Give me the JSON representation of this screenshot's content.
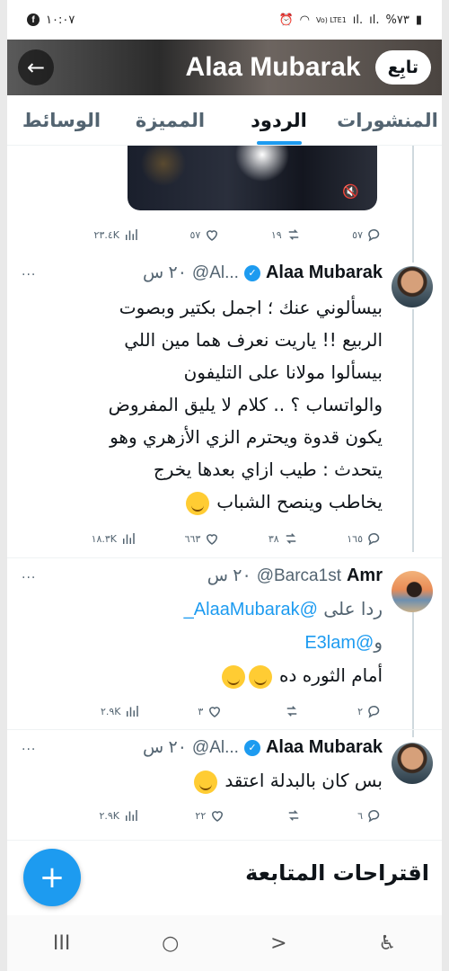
{
  "status_bar": {
    "battery": "%٧٣",
    "network_label": "Vo) LTE1",
    "time": "١٠:٠٧",
    "fb_letter": "f"
  },
  "header": {
    "title": "Alaa Mubarak",
    "follow_label": "تابِع"
  },
  "tabs": [
    {
      "label": "المنشورات",
      "active": false
    },
    {
      "label": "الردود",
      "active": true
    },
    {
      "label": "المميزة",
      "active": false
    },
    {
      "label": "الوسائط",
      "active": false
    }
  ],
  "first_actions": {
    "replies": "٥٧",
    "reposts": "١٩",
    "likes": "٥٧",
    "views": "٢٣.٤K"
  },
  "tweets": [
    {
      "name": "Alaa Mubarak",
      "handle": "@Al...",
      "time": "٢٠ س",
      "lines": [
        "بيسألوني عنك ؛ اجمل بكتير وبصوت",
        "الربيع !! ياريت نعرف هما مين اللي",
        "بيسألوا مولانا على التليفون",
        "والواتساب ؟ .. كلام لا يليق المفروض",
        "يكون قدوة ويحترم الزي الأزهري وهو",
        "يتحدث : طيب ازاي بعدها يخرج",
        "يخاطب وينصح الشباب"
      ],
      "actions": {
        "replies": "١٦٥",
        "reposts": "٣٨",
        "likes": "٦٦٣",
        "views": "١٨.٣K"
      }
    },
    {
      "name": "Amr",
      "handle": "@Barca1st",
      "time": "٢٠ س",
      "reply_prefix": "ردا على",
      "mention1": "@AlaaMubarak_",
      "conj": "و",
      "mention2": "@E3lam",
      "text": "أمام الثوره ده",
      "actions": {
        "replies": "٢",
        "reposts": "",
        "likes": "٣",
        "views": "٢.٩K"
      }
    },
    {
      "name": "Alaa Mubarak",
      "handle": "@Al...",
      "time": "٢٠ س",
      "text": "بس كان بالبدلة اعتقد",
      "actions": {
        "replies": "٦",
        "reposts": "",
        "likes": "٢٢",
        "views": "٢.٩K"
      }
    }
  ],
  "suggestions": {
    "title": "اقتراحات المتابعة"
  },
  "fab": {
    "label": "+"
  },
  "nav": {
    "recent": "III",
    "home": "○",
    "back": ">",
    "accessibility": "♿"
  },
  "colors": {
    "accent": "#1d9bf0",
    "text": "#0f1419",
    "muted": "#536471"
  }
}
